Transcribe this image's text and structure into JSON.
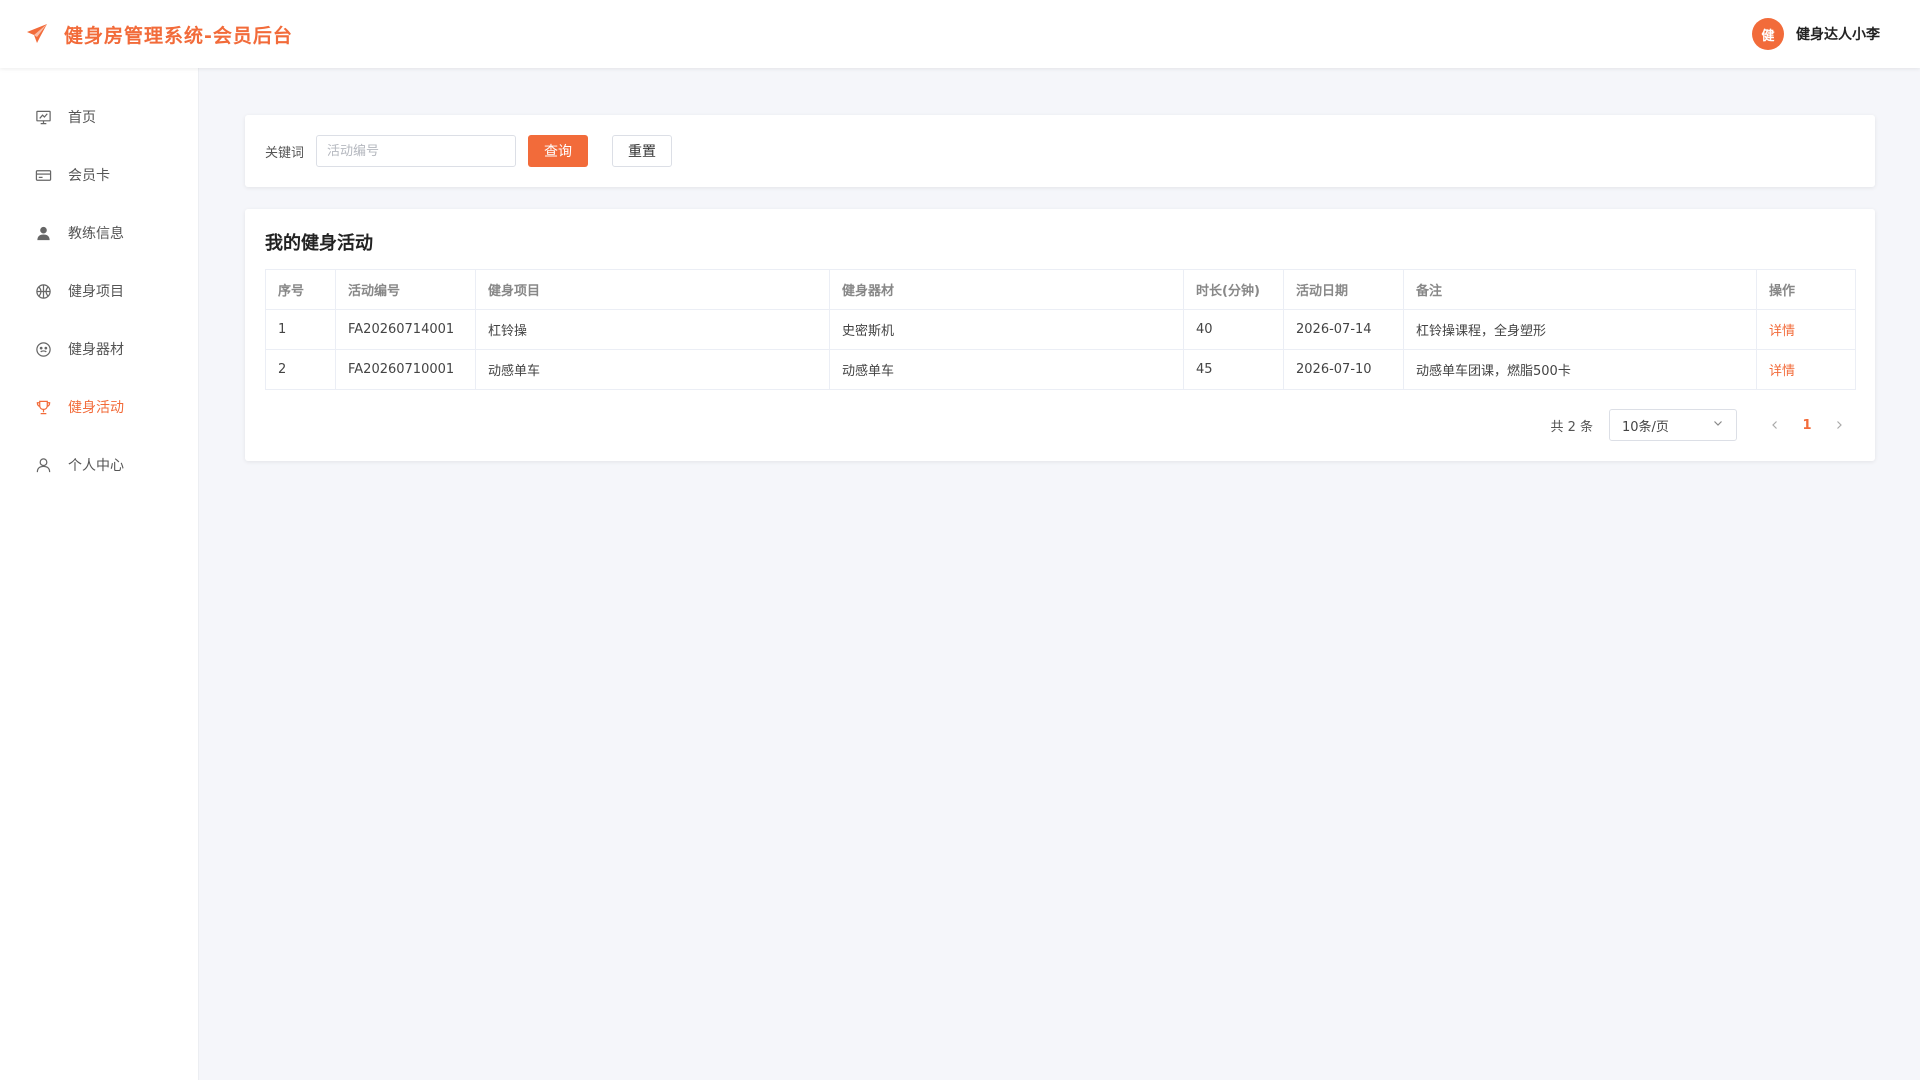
{
  "app": {
    "title": "健身房管理系统-会员后台",
    "user_avatar_text": "健",
    "user_name": "健身达人小李",
    "accent": "#f26b3a"
  },
  "sidebar": {
    "items": [
      {
        "label": "首页",
        "icon": "presentation-board-icon",
        "active": false
      },
      {
        "label": "会员卡",
        "icon": "credit-card-icon",
        "active": false
      },
      {
        "label": "教练信息",
        "icon": "user-solid-icon",
        "active": false
      },
      {
        "label": "健身项目",
        "icon": "basketball-icon",
        "active": false
      },
      {
        "label": "健身器材",
        "icon": "smiley-icon",
        "active": false
      },
      {
        "label": "健身活动",
        "icon": "trophy-icon",
        "active": true
      },
      {
        "label": "个人中心",
        "icon": "user-outline-icon",
        "active": false
      }
    ]
  },
  "search": {
    "label": "关键词",
    "placeholder": "活动编号",
    "value": "",
    "query_label": "查询",
    "reset_label": "重置"
  },
  "table": {
    "title": "我的健身活动",
    "columns": [
      "序号",
      "活动编号",
      "健身项目",
      "健身器材",
      "时长(分钟)",
      "活动日期",
      "备注",
      "操作"
    ],
    "rows": [
      [
        "1",
        "FA20260714001",
        "杠铃操",
        "史密斯机",
        "40",
        "2026-07-14",
        "杠铃操课程，全身塑形",
        "详情"
      ],
      [
        "2",
        "FA20260710001",
        "动感单车",
        "动感单车",
        "45",
        "2026-07-10",
        "动感单车团课，燃脂500卡",
        "详情"
      ]
    ]
  },
  "pagination": {
    "total_text": "共 2 条",
    "page_size": "10条/页",
    "current_page": "1"
  }
}
